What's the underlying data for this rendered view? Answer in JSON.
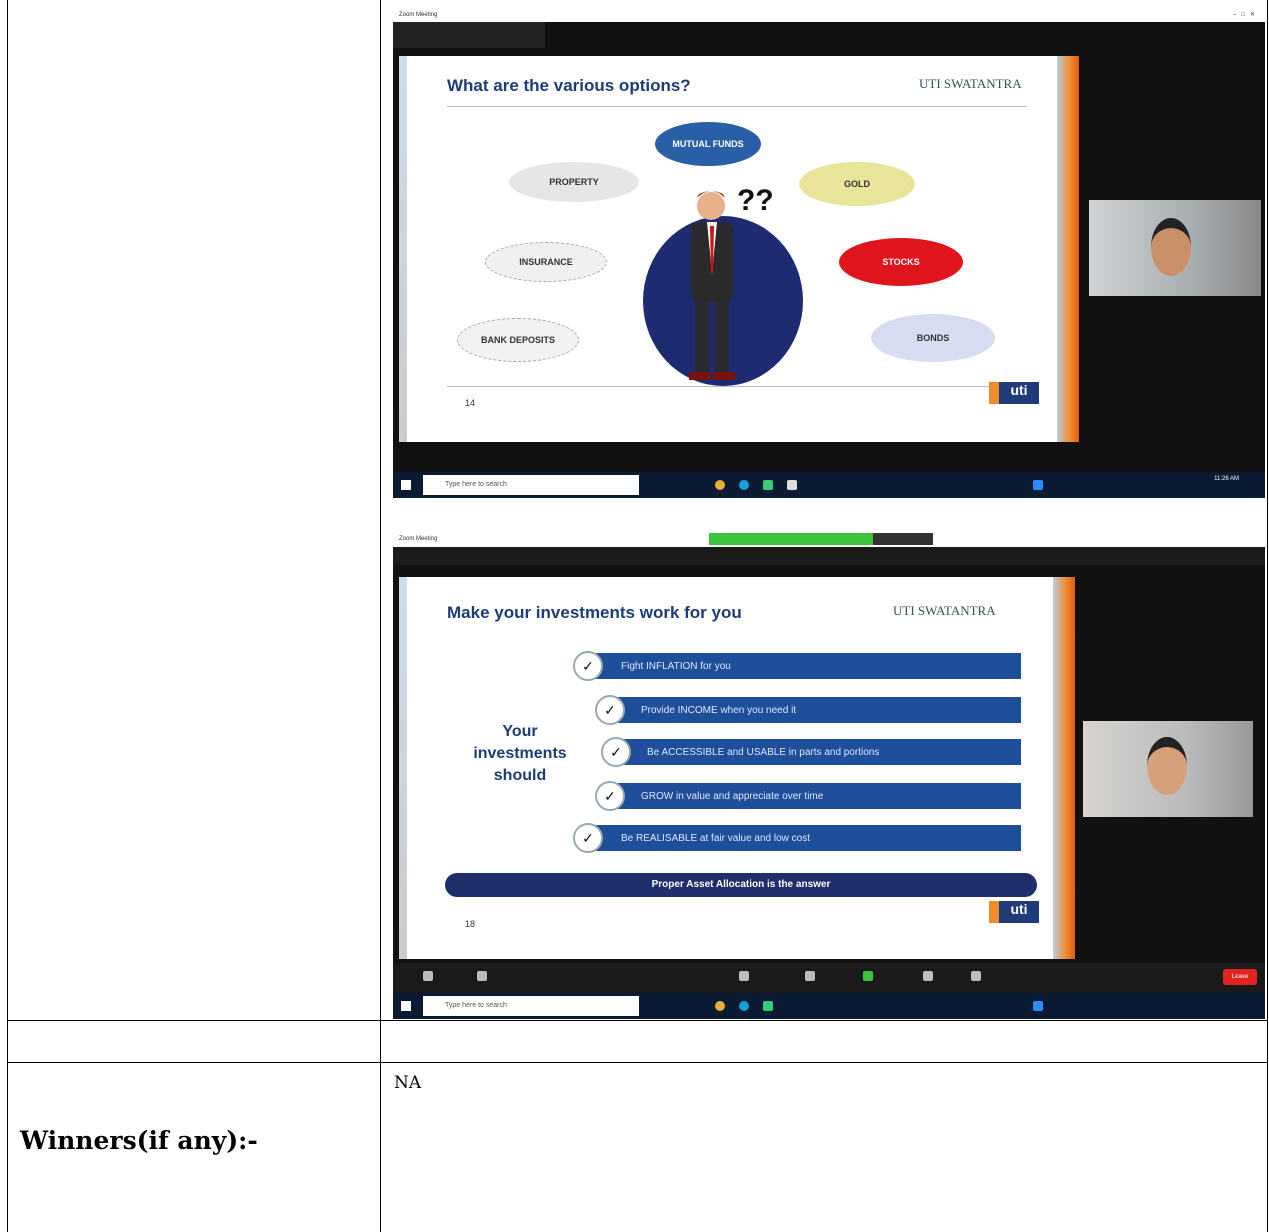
{
  "screenshot1": {
    "window_title": "Zoom Meeting",
    "slide_title": "What are the various options?",
    "brand": "UTI SWATANTRA",
    "bubbles": [
      "MUTUAL FUNDS",
      "PROPERTY",
      "GOLD",
      "INSURANCE",
      "STOCKS",
      "BANK DEPOSITS",
      "BONDS"
    ],
    "page_number": "14",
    "logo_text": "uti",
    "search_placeholder": "Type here to search",
    "clock_time": "11:26 AM"
  },
  "screenshot2": {
    "window_title": "Zoom Meeting",
    "slide_title": "Make your investments work for you",
    "brand": "UTI SWATANTRA",
    "left_heading": [
      "Your",
      "investments",
      "should"
    ],
    "points": [
      "Fight INFLATION for you",
      "Provide INCOME when you need it",
      "Be ACCESSIBLE and USABLE in parts and portions",
      "GROW in value and appreciate over time",
      "Be REALISABLE at fair value and low cost"
    ],
    "footer_bar": "Proper Asset Allocation is the answer",
    "page_number": "18",
    "logo_text": "uti",
    "search_placeholder": "Type here to search",
    "end_button": "Leave"
  },
  "winners_label": "Winners(if any):-",
  "winners_value": "NA"
}
